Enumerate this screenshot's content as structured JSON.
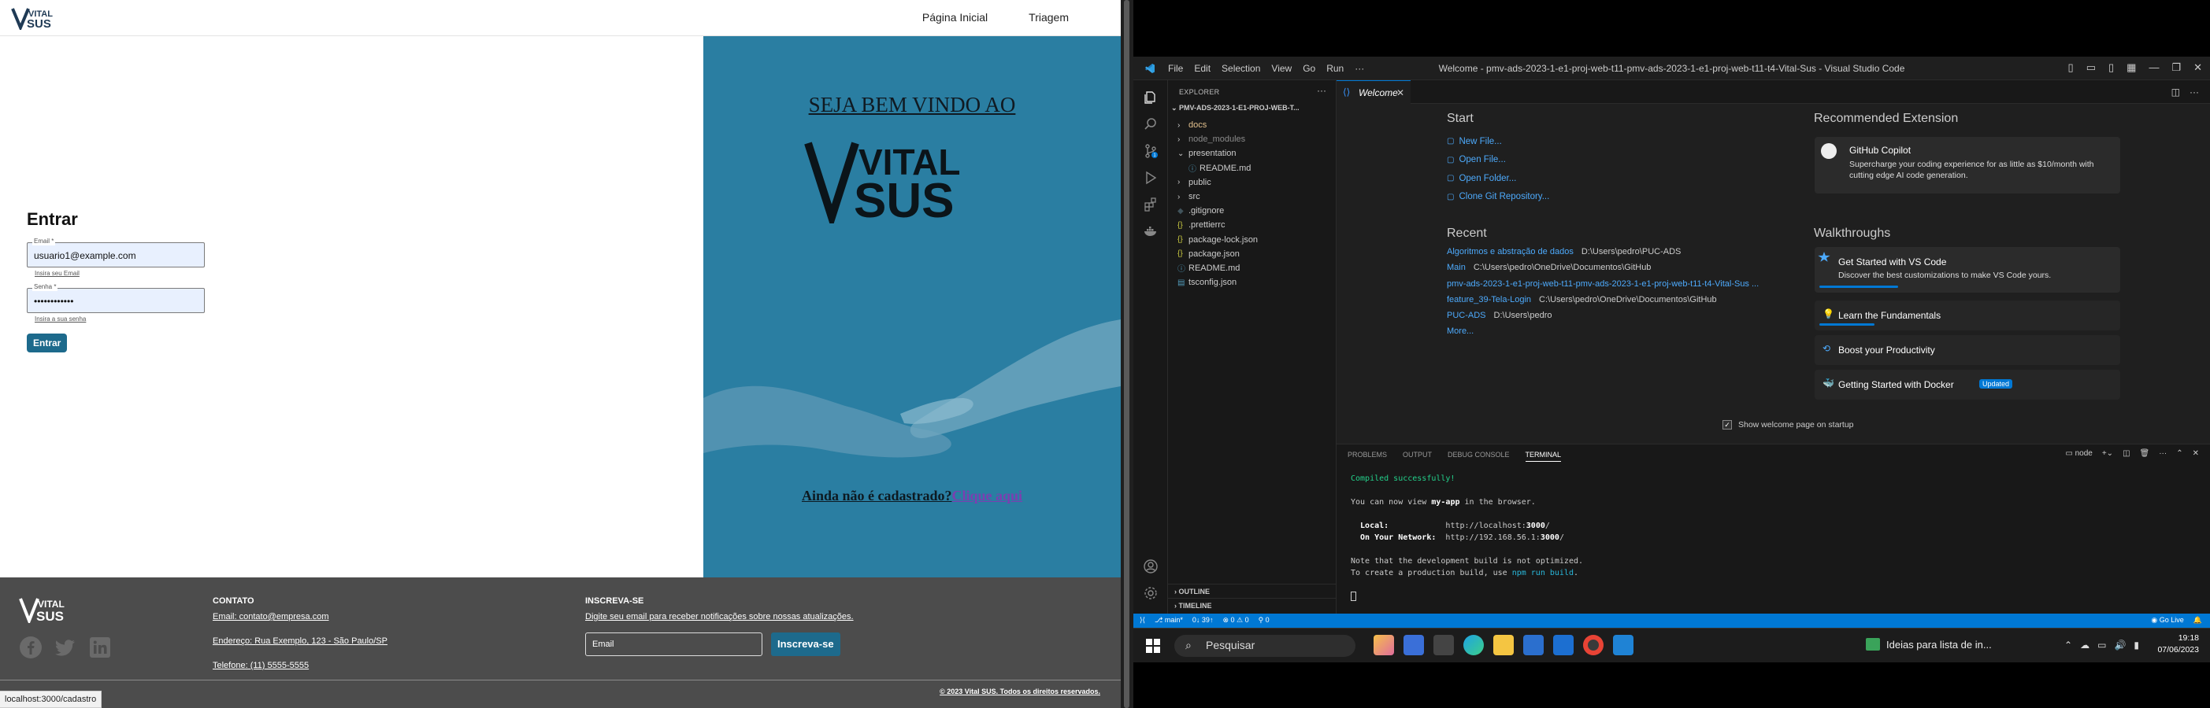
{
  "browser": {
    "nav": {
      "home": "Página Inicial",
      "triage": "Triagem"
    },
    "login": {
      "title": "Entrar",
      "email_label": "Email *",
      "email_value": "usuario1@example.com",
      "email_hint": "Insira seu Email",
      "password_label": "Senha *",
      "password_value": "••••••••••••",
      "password_hint": "Insira a sua senha",
      "submit": "Entrar"
    },
    "hero": {
      "welcome": "SEJA BEM VINDO AO",
      "not_registered": "Ainda não é cadastrado?",
      "click_here": "Clique aqui"
    },
    "footer": {
      "contact_title": "CONTATO",
      "email": "Email: contato@empresa.com",
      "address": "Endereço: Rua Exemplo, 123 - São Paulo/SP",
      "phone": "Telefone: (11) 5555-5555",
      "subscribe_title": "INSCREVA-SE",
      "subscribe_text": "Digite seu email para receber notificações sobre nossas atualizações.",
      "email_placeholder": "Email",
      "subscribe_button": "Inscreva-se",
      "copyright": "© 2023 Vital SUS. Todos os direitos reservados."
    },
    "status_url": "localhost:3000/cadastro"
  },
  "vscode": {
    "menu": [
      "File",
      "Edit",
      "Selection",
      "View",
      "Go",
      "Run",
      "···"
    ],
    "window_title": "Welcome - pmv-ads-2023-1-e1-proj-web-t11-pmv-ads-2023-1-e1-proj-web-t11-t4-Vital-Sus - Visual Studio Code",
    "explorer": {
      "header": "EXPLORER",
      "root": "PMV-ADS-2023-1-E1-PROJ-WEB-T...",
      "items": [
        {
          "label": "docs",
          "indent": 1,
          "kind": "folder",
          "color": "orange"
        },
        {
          "label": "node_modules",
          "indent": 1,
          "kind": "folder",
          "color": "dim"
        },
        {
          "label": "presentation",
          "indent": 1,
          "kind": "folder-open",
          "color": "normal"
        },
        {
          "label": "README.md",
          "indent": 2,
          "kind": "info",
          "color": "normal"
        },
        {
          "label": "public",
          "indent": 1,
          "kind": "folder",
          "color": "normal"
        },
        {
          "label": "src",
          "indent": 1,
          "kind": "folder",
          "color": "normal"
        },
        {
          "label": ".gitignore",
          "indent": 1,
          "kind": "git",
          "color": "normal"
        },
        {
          "label": ".prettierrc",
          "indent": 1,
          "kind": "json",
          "color": "normal"
        },
        {
          "label": "package-lock.json",
          "indent": 1,
          "kind": "json",
          "color": "normal"
        },
        {
          "label": "package.json",
          "indent": 1,
          "kind": "json",
          "color": "normal"
        },
        {
          "label": "README.md",
          "indent": 1,
          "kind": "info",
          "color": "normal"
        },
        {
          "label": "tsconfig.json",
          "indent": 1,
          "kind": "ts",
          "color": "normal"
        }
      ],
      "outline": "OUTLINE",
      "timeline": "TIMELINE"
    },
    "tab": "Welcome",
    "welcome": {
      "start_title": "Start",
      "start": [
        "New File...",
        "Open File...",
        "Open Folder...",
        "Clone Git Repository..."
      ],
      "recent_title": "Recent",
      "recent": [
        {
          "name": "Algoritmos e abstração de dados",
          "path": "D:\\Users\\pedro\\PUC-ADS"
        },
        {
          "name": "Main",
          "path": "C:\\Users\\pedro\\OneDrive\\Documentos\\GitHub"
        },
        {
          "name": "pmv-ads-2023-1-e1-proj-web-t11-pmv-ads-2023-1-e1-proj-web-t11-t4-Vital-Sus ...",
          "path": ""
        },
        {
          "name": "feature_39-Tela-Login",
          "path": "C:\\Users\\pedro\\OneDrive\\Documentos\\GitHub"
        },
        {
          "name": "PUC-ADS",
          "path": "D:\\Users\\pedro"
        }
      ],
      "more": "More...",
      "rec_title": "Recommended Extension",
      "rec_name": "GitHub Copilot",
      "rec_desc": "Supercharge your coding experience for as little as $10/month with cutting edge AI code generation.",
      "walk_title": "Walkthroughs",
      "walk1_title": "Get Started with VS Code",
      "walk1_desc": "Discover the best customizations to make VS Code yours.",
      "walk2": "Learn the Fundamentals",
      "walk3": "Boost your Productivity",
      "walk4": "Getting Started with Docker",
      "updated": "Updated",
      "show_on_startup": "Show welcome page on startup"
    },
    "panel": {
      "tabs": [
        "PROBLEMS",
        "OUTPUT",
        "DEBUG CONSOLE",
        "TERMINAL"
      ],
      "terminal_name": "node",
      "line1": "Compiled successfully!",
      "line2a": "You can now view ",
      "line2b": "my-app",
      "line2c": " in the browser.",
      "local_label": "  Local:",
      "local_url_a": "http://localhost:",
      "local_url_b": "3000",
      "local_url_c": "/",
      "net_label": "  On Your Network:",
      "net_url_a": "http://192.168.56.1:",
      "net_url_b": "3000",
      "net_url_c": "/",
      "line5": "Note that the development build is not optimized.",
      "line6a": "To create a production build, use ",
      "line6b": "npm run build",
      "line6c": "."
    },
    "status": {
      "branch": "main*",
      "sync": "0↓ 39↑",
      "problems": "⊗ 0 ⚠ 0",
      "ports": "0",
      "golive": "Go Live"
    }
  },
  "taskbar": {
    "search": "Pesquisar",
    "news": "Ideias para lista de in...",
    "time": "19:18",
    "date": "07/06/2023"
  }
}
